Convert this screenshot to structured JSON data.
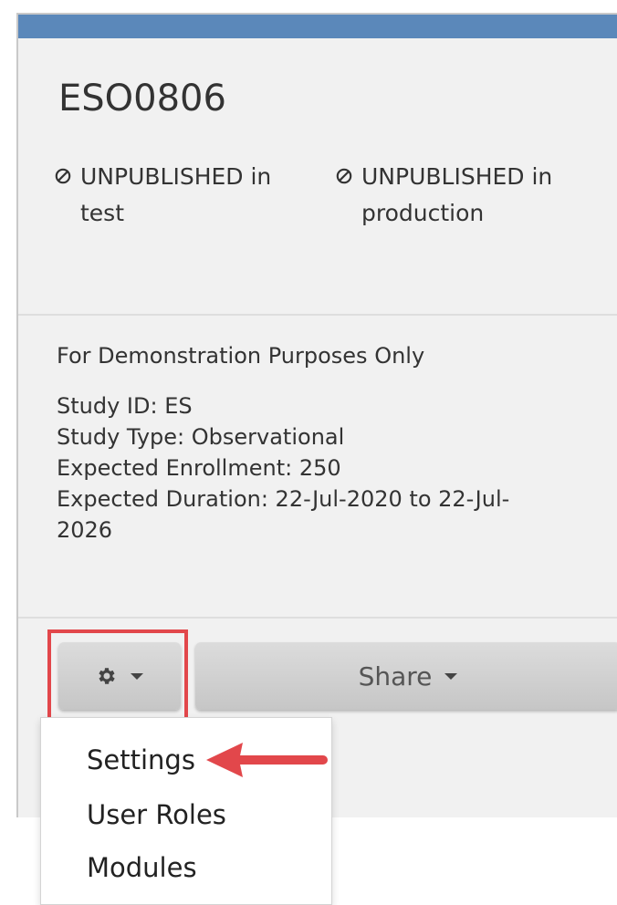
{
  "study": {
    "title": "ESO0806",
    "status_test_line1": "UNPUBLISHED in",
    "status_test_line2": "test",
    "status_prod_line1": "UNPUBLISHED in",
    "status_prod_line2": "production",
    "description": "For Demonstration Purposes Only",
    "details": [
      "Study ID: ES",
      "Study Type: Observational",
      "Expected Enrollment: 250",
      "Expected Duration: 22-Jul-2020 to 22-Jul-",
      "2026"
    ]
  },
  "toolbar": {
    "gear_icon": "gear-icon",
    "share_label": "Share"
  },
  "menu": {
    "items": [
      "Settings",
      "User Roles",
      "Modules"
    ]
  },
  "colors": {
    "top_bar": "#5b88ba",
    "highlight": "#e2474b",
    "card_bg": "#f1f1f1"
  }
}
